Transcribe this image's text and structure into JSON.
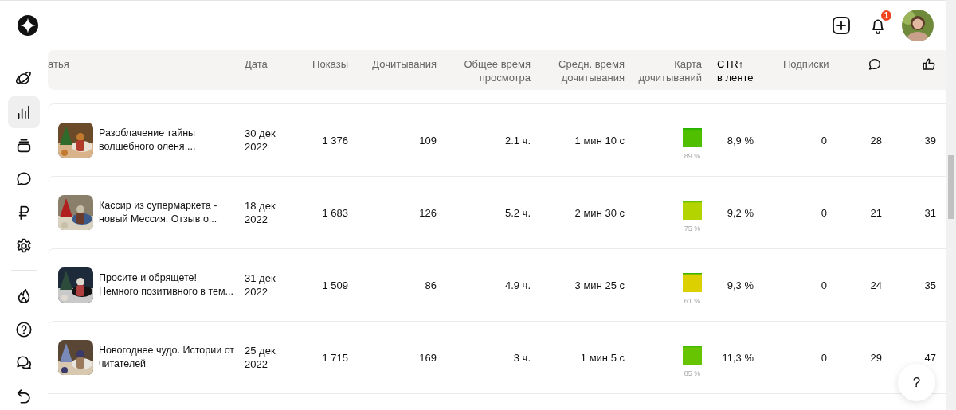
{
  "topbar": {
    "notifications": "1"
  },
  "sidebar": {
    "items": [
      {
        "selected": false
      },
      {
        "selected": true
      },
      {
        "selected": false
      },
      {
        "selected": false
      },
      {
        "selected": false
      },
      {
        "selected": false
      },
      {
        "selected": false
      },
      {
        "selected": false
      },
      {
        "selected": false
      },
      {
        "selected": false
      }
    ]
  },
  "table": {
    "columns": [
      {
        "label": "атья",
        "sorted": false
      },
      {
        "label": "Дата",
        "sorted": false
      },
      {
        "label": "Показы",
        "sorted": false
      },
      {
        "label": "Дочитывания",
        "sorted": false
      },
      {
        "label": "Общее время\nпросмотра",
        "sorted": false
      },
      {
        "label": "Средн. время\nдочитывания",
        "sorted": false
      },
      {
        "label": "Карта\nдочитываний",
        "sorted": false
      },
      {
        "label": "CTR↑\nв ленте",
        "sorted": true
      },
      {
        "label": "Подписки",
        "sorted": false
      }
    ],
    "rows": [
      {
        "title": "Разоблачение тайны\nволшебного оленя....",
        "date": "30 дек\n2022",
        "views": "1 376",
        "reads": "109",
        "total_time": "2.1 ч.",
        "avg_time": "1 мин 10 с",
        "map": {
          "color": "#4fbf00",
          "reading": "89 %"
        },
        "ctr": "8,9 %",
        "subscriptions": "0",
        "comments": "28",
        "likes": "39"
      },
      {
        "title": "Кассир из супермаркета -\nновый Мессия. Отзыв о...",
        "date": "18 дек\n2022",
        "views": "1 683",
        "reads": "126",
        "total_time": "5.2 ч.",
        "avg_time": "2 мин 30 с",
        "map": {
          "color": "#b4d400",
          "reading": "75 %"
        },
        "ctr": "9,2 %",
        "subscriptions": "0",
        "comments": "21",
        "likes": "31"
      },
      {
        "title": "Просите и обрящете!\nНемного позитивного в тем...",
        "date": "31 дек\n2022",
        "views": "1 509",
        "reads": "86",
        "total_time": "4.9 ч.",
        "avg_time": "3 мин 25 с",
        "map": {
          "color": "#dcd000",
          "reading": "61 %"
        },
        "ctr": "9,3 %",
        "subscriptions": "0",
        "comments": "24",
        "likes": "35"
      },
      {
        "title": "Новогоднее чудо. Истории от\nчитателей",
        "date": "25 дек\n2022",
        "views": "1 715",
        "reads": "169",
        "total_time": "3 ч.",
        "avg_time": "1 мин 5 с",
        "map": {
          "color": "#66c400",
          "reading": "85 %"
        },
        "ctr": "11,3 %",
        "subscriptions": "0",
        "comments": "29",
        "likes": "47"
      }
    ]
  },
  "help_button": {
    "label": "?"
  }
}
